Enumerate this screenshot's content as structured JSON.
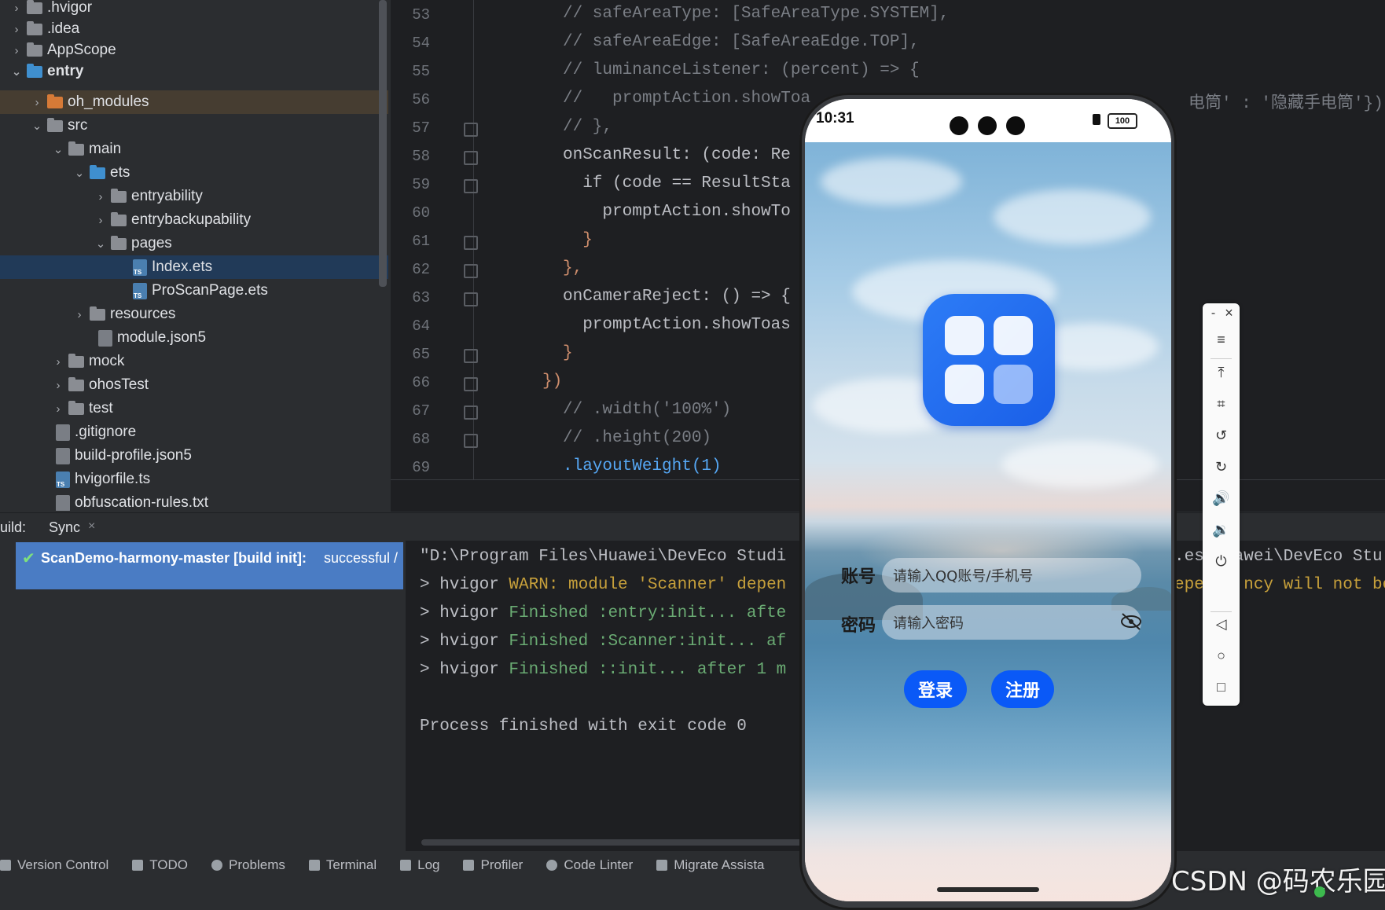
{
  "project_tree": {
    "items": [
      {
        "label": ".hvigor",
        "chevron": "›",
        "type": "folder"
      },
      {
        "label": ".idea",
        "chevron": "›",
        "type": "folder"
      },
      {
        "label": "AppScope",
        "chevron": "›",
        "type": "folder"
      },
      {
        "label": "entry",
        "chevron": "⌄",
        "type": "folder"
      },
      {
        "label": "oh_modules",
        "chevron": "›",
        "type": "folder-orange"
      },
      {
        "label": "src",
        "chevron": "⌄",
        "type": "folder"
      },
      {
        "label": "main",
        "chevron": "⌄",
        "type": "folder"
      },
      {
        "label": "ets",
        "chevron": "⌄",
        "type": "folder-blue"
      },
      {
        "label": "entryability",
        "chevron": "›",
        "type": "folder"
      },
      {
        "label": "entrybackupability",
        "chevron": "›",
        "type": "folder"
      },
      {
        "label": "pages",
        "chevron": "⌄",
        "type": "folder"
      },
      {
        "label": "Index.ets",
        "chevron": "",
        "type": "ts-file"
      },
      {
        "label": "ProScanPage.ets",
        "chevron": "",
        "type": "ts-file"
      },
      {
        "label": "resources",
        "chevron": "›",
        "type": "folder"
      },
      {
        "label": "module.json5",
        "chevron": "",
        "type": "file"
      },
      {
        "label": "mock",
        "chevron": "›",
        "type": "folder"
      },
      {
        "label": "ohosTest",
        "chevron": "›",
        "type": "folder"
      },
      {
        "label": "test",
        "chevron": "›",
        "type": "folder"
      },
      {
        "label": ".gitignore",
        "chevron": "",
        "type": "file"
      },
      {
        "label": "build-profile.json5",
        "chevron": "",
        "type": "file"
      },
      {
        "label": "hvigorfile.ts",
        "chevron": "",
        "type": "ts-file"
      },
      {
        "label": "obfuscation-rules.txt",
        "chevron": "",
        "type": "file"
      }
    ]
  },
  "editor": {
    "lines": [
      {
        "num": "53",
        "text": "// safeAreaType: [SafeAreaType.SYSTEM],"
      },
      {
        "num": "54",
        "text": "// safeAreaEdge: [SafeAreaEdge.TOP],"
      },
      {
        "num": "55",
        "text": "// luminanceListener: (percent) => {"
      },
      {
        "num": "56",
        "text": "//   promptAction.showToa",
        "tail": "电筒' : '隐藏手电筒'})"
      },
      {
        "num": "57",
        "text": "// },"
      },
      {
        "num": "58",
        "text": "onScanResult: (code: Re"
      },
      {
        "num": "59",
        "text": "  if (code == ResultSta"
      },
      {
        "num": "60",
        "text": "    promptAction.showTo"
      },
      {
        "num": "61",
        "text": "  }"
      },
      {
        "num": "62",
        "text": "},"
      },
      {
        "num": "63",
        "text": "onCameraReject: () => {"
      },
      {
        "num": "64",
        "text": "  promptAction.showToas"
      },
      {
        "num": "65",
        "text": "}"
      },
      {
        "num": "66",
        "text": "})"
      },
      {
        "num": "67",
        "text": "// .width('100%')"
      },
      {
        "num": "68",
        "text": "// .height(200)"
      },
      {
        "num": "69",
        "text": ".layoutWeight(1)"
      }
    ]
  },
  "build_panel": {
    "label": "uild:",
    "tab": "Sync",
    "tab_close": "×",
    "task": "ScanDemo-harmony-master [build init]:",
    "task_status": "successful /",
    "console": {
      "l1": "\"D:\\Program Files\\Huawei\\DevEco Studi",
      "l1_tail": ".es\\Huawei\\DevEco Stu",
      "l2_prefix": "> hvigor ",
      "l2_warn": "WARN: module 'Scanner' depen",
      "l2_tail": "epe    ncy will not be",
      "l3_prefix": "> hvigor ",
      "l3_ok": "Finished :entry:init... afte",
      "l4_prefix": "> hvigor ",
      "l4_ok": "Finished :Scanner:init... af",
      "l5_prefix": "> hvigor ",
      "l5_ok": "Finished ::init... after 1 m",
      "l6": "Process finished with exit code 0"
    }
  },
  "status_bar": {
    "items": [
      "Version Control",
      "TODO",
      "Problems",
      "Terminal",
      "Log",
      "Profiler",
      "Code Linter",
      "Migrate Assista"
    ]
  },
  "phone": {
    "time": "10:31",
    "battery": "100",
    "account_label": "账号",
    "account_placeholder": "请输入QQ账号/手机号",
    "password_label": "密码",
    "password_placeholder": "请输入密码",
    "login_button": "登录",
    "register_button": "注册"
  },
  "emulator_toolbar": {
    "minimize": "-",
    "close": "×"
  },
  "watermark": "CSDN @码农乐园",
  "colors": {
    "editor_bg": "#1e1f22",
    "tree_selection": "#213a58",
    "build_selection": "#4a7cc4",
    "phone_button": "#0a59f7",
    "warn": "#c7a03b",
    "ok": "#6aab73"
  }
}
